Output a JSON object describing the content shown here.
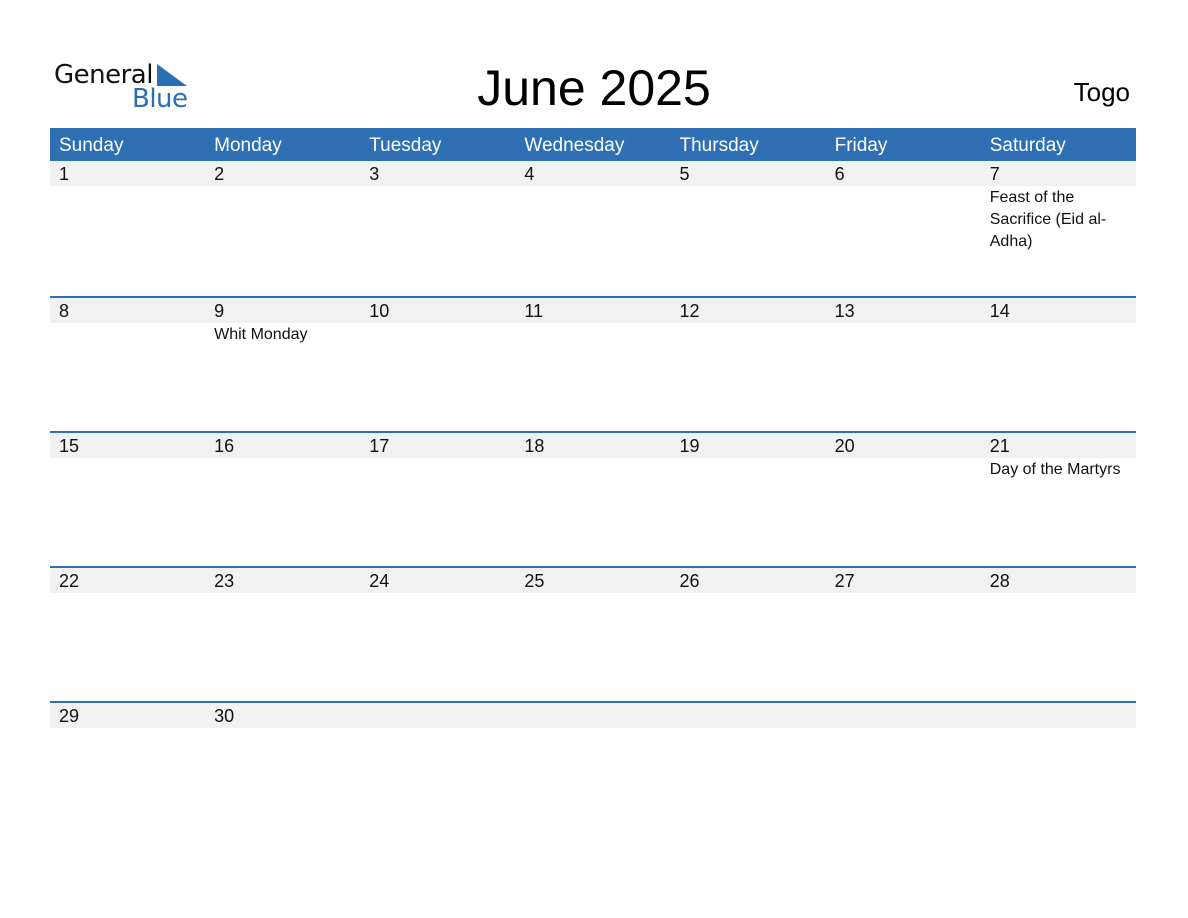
{
  "logo": {
    "line1": "General",
    "line2": "Blue"
  },
  "title": "June 2025",
  "country": "Togo",
  "colors": {
    "accent": "#2e70b3",
    "date_strip": "#f1f1f1"
  },
  "weekdays": [
    "Sunday",
    "Monday",
    "Tuesday",
    "Wednesday",
    "Thursday",
    "Friday",
    "Saturday"
  ],
  "weeks": [
    {
      "days": [
        "1",
        "2",
        "3",
        "4",
        "5",
        "6",
        "7"
      ],
      "events": [
        "",
        "",
        "",
        "",
        "",
        "",
        "Feast of the Sacrifice (Eid al-Adha)"
      ]
    },
    {
      "days": [
        "8",
        "9",
        "10",
        "11",
        "12",
        "13",
        "14"
      ],
      "events": [
        "",
        "Whit Monday",
        "",
        "",
        "",
        "",
        ""
      ]
    },
    {
      "days": [
        "15",
        "16",
        "17",
        "18",
        "19",
        "20",
        "21"
      ],
      "events": [
        "",
        "",
        "",
        "",
        "",
        "",
        "Day of the Martyrs"
      ]
    },
    {
      "days": [
        "22",
        "23",
        "24",
        "25",
        "26",
        "27",
        "28"
      ],
      "events": [
        "",
        "",
        "",
        "",
        "",
        "",
        ""
      ]
    },
    {
      "days": [
        "29",
        "30",
        "",
        "",
        "",
        "",
        ""
      ],
      "events": [
        "",
        "",
        "",
        "",
        "",
        "",
        ""
      ]
    }
  ]
}
